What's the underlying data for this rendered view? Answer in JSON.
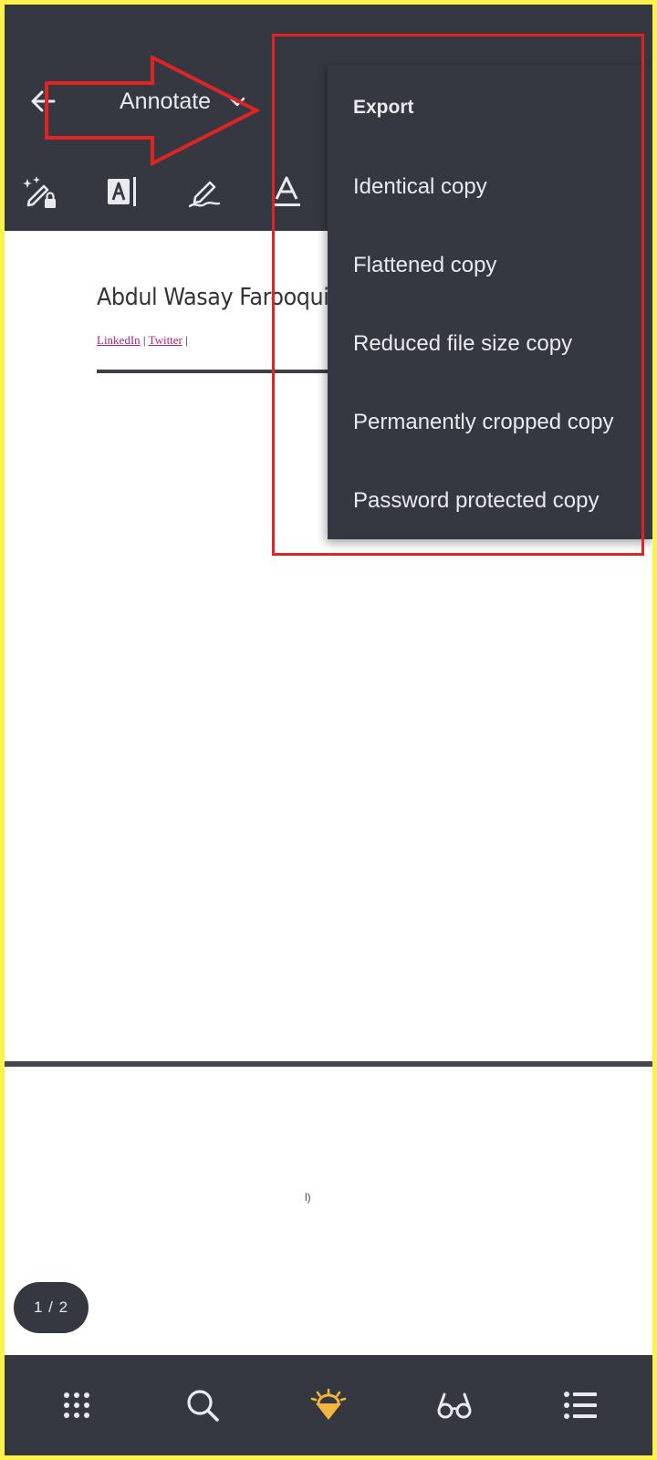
{
  "header": {
    "title": "Annotate"
  },
  "toolbar": {
    "tools": [
      {
        "name": "magic-pen-lock-icon"
      },
      {
        "name": "text-field-icon"
      },
      {
        "name": "signature-pen-icon"
      },
      {
        "name": "text-style-icon"
      }
    ]
  },
  "document": {
    "author_name": "Abdul Wasay Farooqui",
    "link_linkedin": "LinkedIn",
    "link_twitter": "Twitter",
    "separator": "|",
    "page2_mark": "l)"
  },
  "pager": {
    "label": "1 / 2"
  },
  "export_menu": {
    "header": "Export",
    "items": [
      {
        "label": "Identical copy"
      },
      {
        "label": "Flattened copy"
      },
      {
        "label": "Reduced file size copy"
      },
      {
        "label": "Permanently cropped copy"
      },
      {
        "label": "Password protected copy"
      }
    ]
  },
  "bottom_nav": {
    "items": [
      {
        "name": "grid-icon"
      },
      {
        "name": "search-icon"
      },
      {
        "name": "lamp-icon",
        "active": true
      },
      {
        "name": "reading-glasses-icon"
      },
      {
        "name": "list-icon"
      }
    ]
  },
  "colors": {
    "toolbar_bg": "#353840",
    "text_light": "#e9eaee",
    "accent": "#f4b53f",
    "highlight_red": "#e02424",
    "frame_yellow": "#fbf24a",
    "link_magenta": "#b02080"
  }
}
